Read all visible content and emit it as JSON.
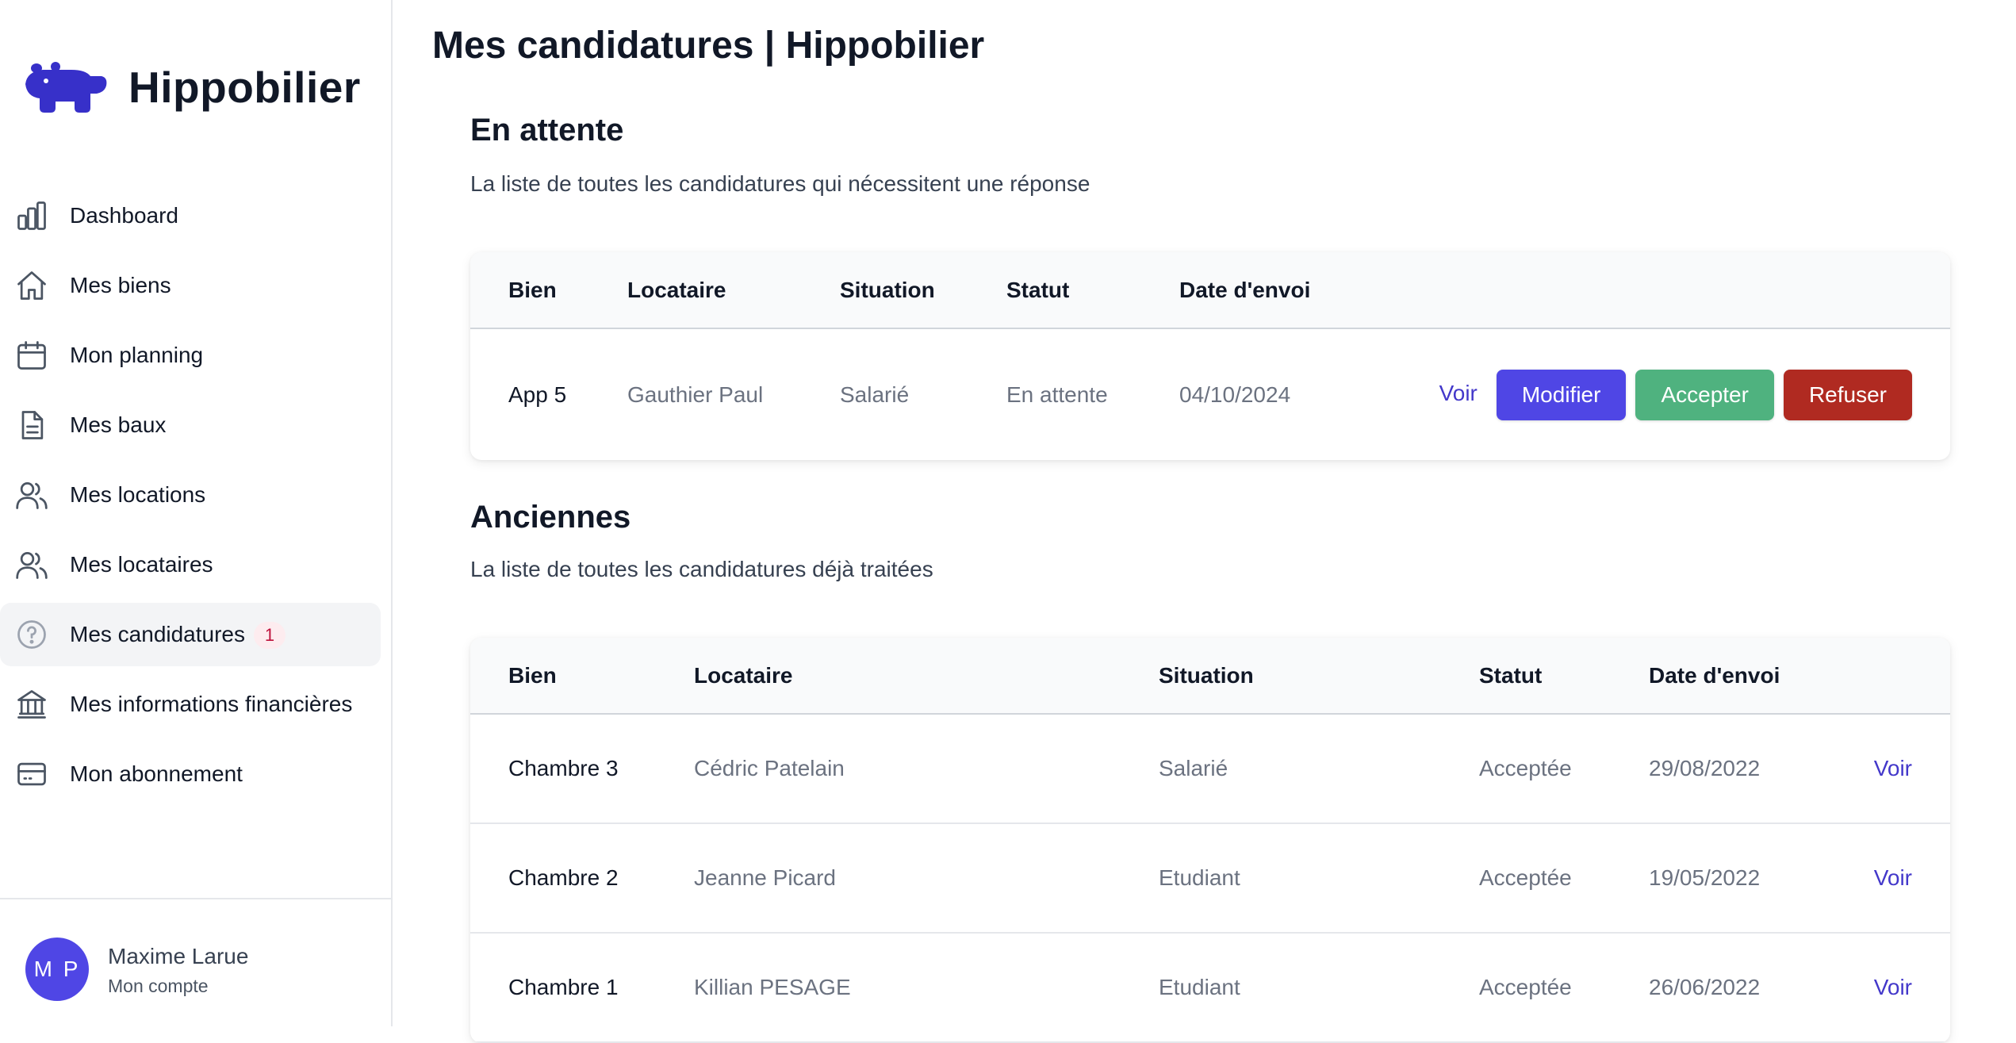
{
  "brand": {
    "name": "Hippobilier",
    "logo_icon": "hippo-logo-icon",
    "color": "#3730c9"
  },
  "sidebar": {
    "items": [
      {
        "label": "Dashboard",
        "icon": "chart-bar-icon"
      },
      {
        "label": "Mes biens",
        "icon": "home-icon"
      },
      {
        "label": "Mon planning",
        "icon": "calendar-icon"
      },
      {
        "label": "Mes baux",
        "icon": "document-icon"
      },
      {
        "label": "Mes locations",
        "icon": "users-icon"
      },
      {
        "label": "Mes locataires",
        "icon": "users-icon"
      },
      {
        "label": "Mes candidatures",
        "icon": "question-circle-icon",
        "badge": "1",
        "active": true
      },
      {
        "label": "Mes informations financières",
        "icon": "bank-icon"
      },
      {
        "label": "Mon abonnement",
        "icon": "credit-card-icon"
      }
    ]
  },
  "user": {
    "initials": "M P",
    "name": "Maxime Larue",
    "subtitle": "Mon compte"
  },
  "page": {
    "title": "Mes candidatures | Hippobilier"
  },
  "pending": {
    "title": "En attente",
    "description": "La liste de toutes les candidatures qui nécessitent une réponse",
    "headers": {
      "bien": "Bien",
      "locataire": "Locataire",
      "situation": "Situation",
      "statut": "Statut",
      "date": "Date d'envoi"
    },
    "rows": [
      {
        "bien": "App 5",
        "locataire": "Gauthier Paul",
        "situation": "Salarié",
        "statut": "En attente",
        "date": "04/10/2024"
      }
    ],
    "actions": {
      "voir": "Voir",
      "modifier": "Modifier",
      "accepter": "Accepter",
      "refuser": "Refuser"
    }
  },
  "old": {
    "title": "Anciennes",
    "description": "La liste de toutes les candidatures déjà traitées",
    "headers": {
      "bien": "Bien",
      "locataire": "Locataire",
      "situation": "Situation",
      "statut": "Statut",
      "date": "Date d'envoi"
    },
    "rows": [
      {
        "bien": "Chambre 3",
        "locataire": "Cédric Patelain",
        "situation": "Salarié",
        "statut": "Acceptée",
        "date": "29/08/2022",
        "voir": "Voir"
      },
      {
        "bien": "Chambre 2",
        "locataire": "Jeanne Picard",
        "situation": "Etudiant",
        "statut": "Acceptée",
        "date": "19/05/2022",
        "voir": "Voir"
      },
      {
        "bien": "Chambre 1",
        "locataire": "Killian PESAGE",
        "situation": "Etudiant",
        "statut": "Acceptée",
        "date": "26/06/2022",
        "voir": "Voir"
      }
    ]
  },
  "colors": {
    "primary": "#4f46e5",
    "success": "#4fb27f",
    "danger": "#b02a21",
    "link": "#4338ca"
  }
}
